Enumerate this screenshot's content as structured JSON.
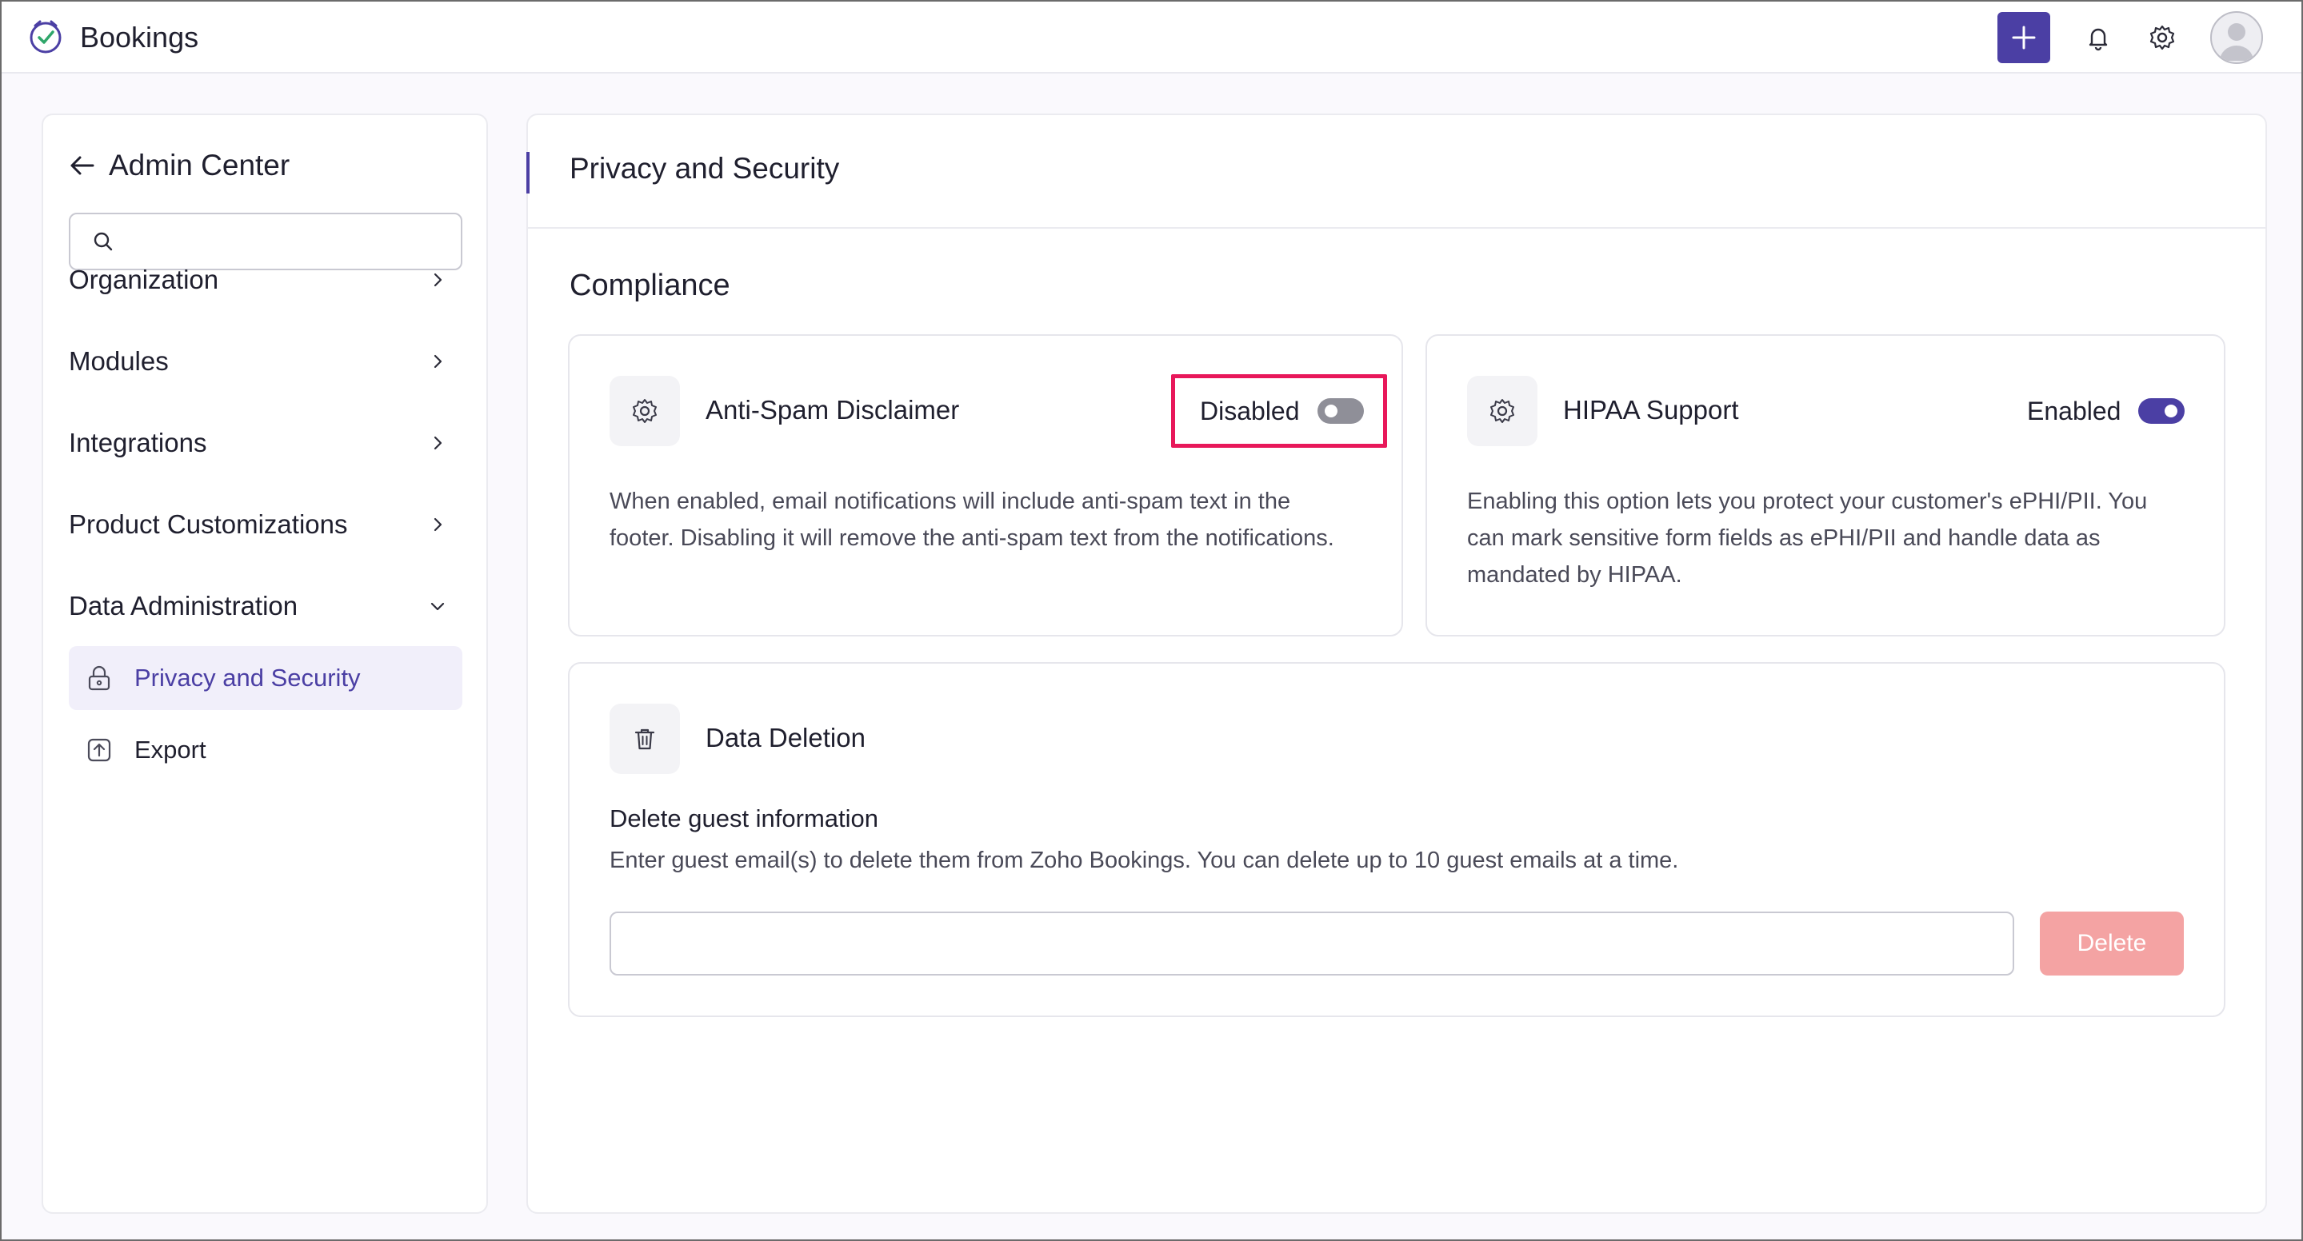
{
  "app": {
    "name": "Bookings"
  },
  "topbar": {
    "icons": [
      "plus-icon",
      "bell-icon",
      "gear-icon",
      "avatar"
    ]
  },
  "sidebar": {
    "title": "Admin Center",
    "search": {
      "placeholder": "",
      "value": ""
    },
    "items": [
      {
        "label": "Organization",
        "icon": "chevron-right-icon"
      },
      {
        "label": "Modules",
        "icon": "chevron-right-icon"
      },
      {
        "label": "Integrations",
        "icon": "chevron-right-icon"
      },
      {
        "label": "Product Customizations",
        "icon": "chevron-right-icon"
      },
      {
        "label": "Data Administration",
        "icon": "chevron-down-icon"
      }
    ],
    "sub_items": [
      {
        "label": "Privacy and Security",
        "icon": "lock-icon",
        "active": true
      },
      {
        "label": "Export",
        "icon": "export-icon",
        "active": false
      }
    ]
  },
  "main": {
    "title": "Privacy and Security",
    "section": "Compliance",
    "anti_spam": {
      "title": "Anti-Spam Disclaimer",
      "status": "Disabled",
      "enabled": false,
      "desc_line1": "When enabled, email notifications will include anti-spam text in the",
      "desc_line2": "footer. Disabling it will remove the anti-spam text from the notifications."
    },
    "hipaa": {
      "title": "HIPAA Support",
      "status": "Enabled",
      "enabled": true,
      "desc_line1": "Enabling this option lets you protect your customer's ePHI/PII. You",
      "desc_line2": "can mark sensitive form fields as ePHI/PII and handle data as",
      "desc_line3": "mandated by HIPAA."
    },
    "deletion": {
      "title": "Data Deletion",
      "subtitle": "Delete guest information",
      "description": "Enter guest email(s) to delete them from Zoho Bookings. You can delete up to 10 guest emails at a time.",
      "input_placeholder": "",
      "input_value": "",
      "button_label": "Delete"
    }
  },
  "colors": {
    "accent": "#4b3fa4",
    "highlight": "#e8185a",
    "delete_button": "#f4a3a3"
  }
}
